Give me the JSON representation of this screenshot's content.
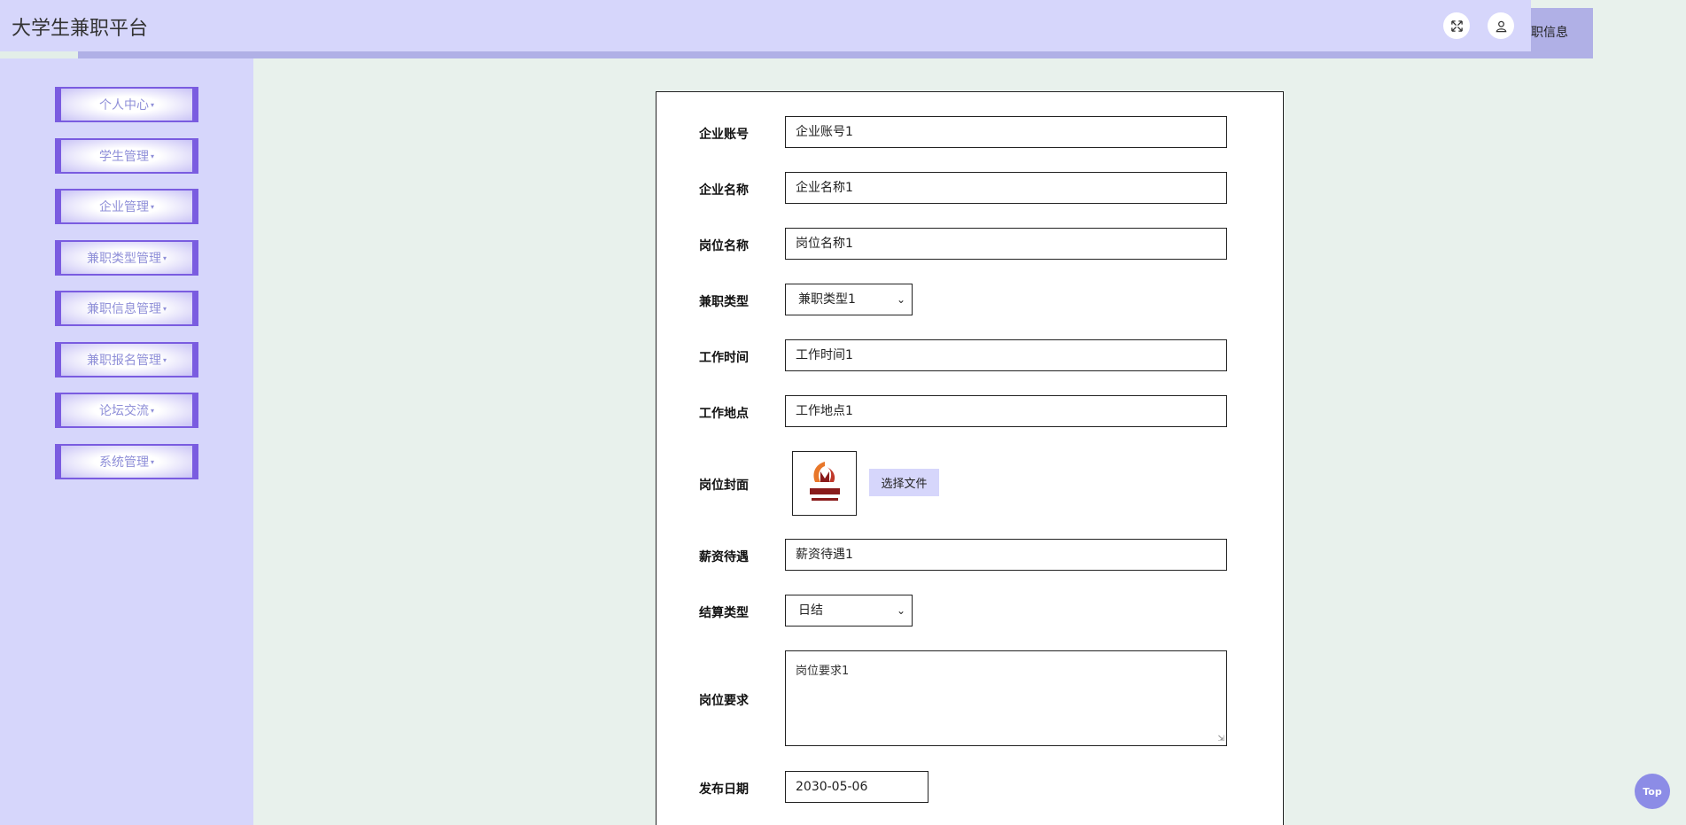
{
  "header": {
    "title": "大学生兼职平台",
    "tab_label": "职信息",
    "icons": [
      "fullscreen-icon",
      "user-icon"
    ]
  },
  "sidebar": {
    "items": [
      {
        "label": "个人中心"
      },
      {
        "label": "学生管理"
      },
      {
        "label": "企业管理"
      },
      {
        "label": "兼职类型管理"
      },
      {
        "label": "兼职信息管理"
      },
      {
        "label": "兼职报名管理"
      },
      {
        "label": "论坛交流"
      },
      {
        "label": "系统管理"
      }
    ],
    "caret": "▾"
  },
  "form": {
    "company_account": {
      "label": "企业账号",
      "value": "企业账号1"
    },
    "company_name": {
      "label": "企业名称",
      "value": "企业名称1"
    },
    "position_name": {
      "label": "岗位名称",
      "value": "岗位名称1"
    },
    "job_type": {
      "label": "兼职类型",
      "value": "兼职类型1"
    },
    "work_time": {
      "label": "工作时间",
      "value": "工作时间1"
    },
    "work_place": {
      "label": "工作地点",
      "value": "工作地点1"
    },
    "cover": {
      "label": "岗位封面",
      "button": "选择文件"
    },
    "salary": {
      "label": "薪资待遇",
      "value": "薪资待遇1"
    },
    "settlement": {
      "label": "结算类型",
      "value": "日结"
    },
    "requirements": {
      "label": "岗位要求",
      "value": "岗位要求1"
    },
    "publish_date": {
      "label": "发布日期",
      "value": "2030-05-06"
    }
  },
  "top_button": "Top",
  "colors": {
    "accent": "#d6d6fb",
    "menu_border": "#7a5ce0",
    "background": "#e8f1ec"
  }
}
